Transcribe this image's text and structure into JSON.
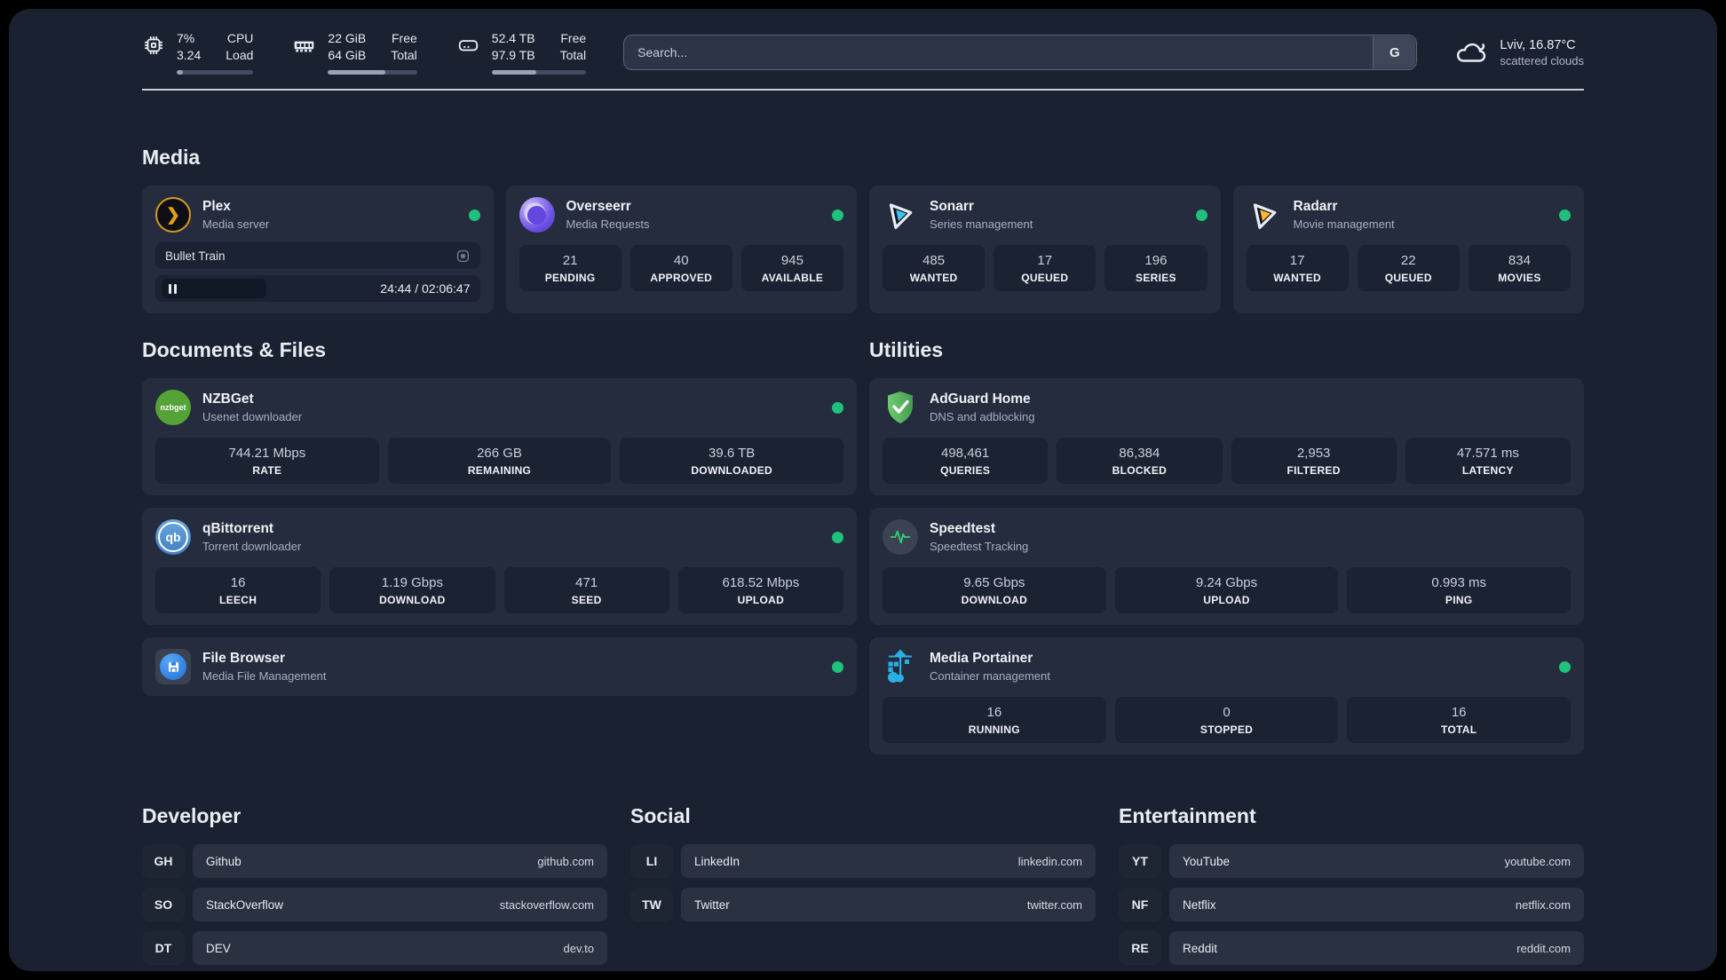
{
  "topbar": {
    "cpu": {
      "v1": "7%",
      "v2": "3.24",
      "l1": "CPU",
      "l2": "Load",
      "progress": 8
    },
    "ram": {
      "v1": "22 GiB",
      "v2": "64 GiB",
      "l1": "Free",
      "l2": "Total",
      "progress": 64
    },
    "disk": {
      "v1": "52.4 TB",
      "v2": "97.9 TB",
      "l1": "Free",
      "l2": "Total",
      "progress": 47
    },
    "search": {
      "placeholder": "Search...",
      "button_label": "G"
    },
    "weather": {
      "line1": "Lviv, 16.87°C",
      "line2": "scattered clouds"
    }
  },
  "media": {
    "title": "Media",
    "plex": {
      "name": "Plex",
      "subtitle": "Media server",
      "now_playing": "Bullet Train",
      "time": "24:44 / 02:06:47"
    },
    "overseerr": {
      "name": "Overseerr",
      "subtitle": "Media Requests",
      "stats": [
        {
          "value": "21",
          "label": "PENDING"
        },
        {
          "value": "40",
          "label": "APPROVED"
        },
        {
          "value": "945",
          "label": "AVAILABLE"
        }
      ]
    },
    "sonarr": {
      "name": "Sonarr",
      "subtitle": "Series management",
      "stats": [
        {
          "value": "485",
          "label": "WANTED"
        },
        {
          "value": "17",
          "label": "QUEUED"
        },
        {
          "value": "196",
          "label": "SERIES"
        }
      ]
    },
    "radarr": {
      "name": "Radarr",
      "subtitle": "Movie management",
      "stats": [
        {
          "value": "17",
          "label": "WANTED"
        },
        {
          "value": "22",
          "label": "QUEUED"
        },
        {
          "value": "834",
          "label": "MOVIES"
        }
      ]
    }
  },
  "documents": {
    "title": "Documents & Files",
    "nzbget": {
      "name": "NZBGet",
      "subtitle": "Usenet downloader",
      "stats": [
        {
          "value": "744.21 Mbps",
          "label": "RATE"
        },
        {
          "value": "266 GB",
          "label": "REMAINING"
        },
        {
          "value": "39.6 TB",
          "label": "DOWNLOADED"
        }
      ]
    },
    "qbittorrent": {
      "name": "qBittorrent",
      "subtitle": "Torrent downloader",
      "stats": [
        {
          "value": "16",
          "label": "LEECH"
        },
        {
          "value": "1.19 Gbps",
          "label": "DOWNLOAD"
        },
        {
          "value": "471",
          "label": "SEED"
        },
        {
          "value": "618.52 Mbps",
          "label": "UPLOAD"
        }
      ]
    },
    "filebrowser": {
      "name": "File Browser",
      "subtitle": "Media File Management"
    }
  },
  "utilities": {
    "title": "Utilities",
    "adguard": {
      "name": "AdGuard Home",
      "subtitle": "DNS and adblocking",
      "stats": [
        {
          "value": "498,461",
          "label": "QUERIES"
        },
        {
          "value": "86,384",
          "label": "BLOCKED"
        },
        {
          "value": "2,953",
          "label": "FILTERED"
        },
        {
          "value": "47.571 ms",
          "label": "LATENCY"
        }
      ]
    },
    "speedtest": {
      "name": "Speedtest",
      "subtitle": "Speedtest Tracking",
      "stats": [
        {
          "value": "9.65 Gbps",
          "label": "DOWNLOAD"
        },
        {
          "value": "9.24 Gbps",
          "label": "UPLOAD"
        },
        {
          "value": "0.993 ms",
          "label": "PING"
        }
      ]
    },
    "portainer": {
      "name": "Media Portainer",
      "subtitle": "Container management",
      "stats": [
        {
          "value": "16",
          "label": "RUNNING"
        },
        {
          "value": "0",
          "label": "STOPPED"
        },
        {
          "value": "16",
          "label": "TOTAL"
        }
      ]
    }
  },
  "bookmarks": {
    "developer": {
      "title": "Developer",
      "links": [
        {
          "abbr": "GH",
          "name": "Github",
          "url": "github.com"
        },
        {
          "abbr": "SO",
          "name": "StackOverflow",
          "url": "stackoverflow.com"
        },
        {
          "abbr": "DT",
          "name": "DEV",
          "url": "dev.to"
        }
      ]
    },
    "social": {
      "title": "Social",
      "links": [
        {
          "abbr": "LI",
          "name": "LinkedIn",
          "url": "linkedin.com"
        },
        {
          "abbr": "TW",
          "name": "Twitter",
          "url": "twitter.com"
        }
      ]
    },
    "entertainment": {
      "title": "Entertainment",
      "links": [
        {
          "abbr": "YT",
          "name": "YouTube",
          "url": "youtube.com"
        },
        {
          "abbr": "NF",
          "name": "Netflix",
          "url": "netflix.com"
        },
        {
          "abbr": "RE",
          "name": "Reddit",
          "url": "reddit.com"
        }
      ]
    }
  },
  "icons": {
    "plex_glyph": "❯",
    "nzbget_text": "nzbget",
    "qbittorrent_text": "qb"
  },
  "colors": {
    "status_online": "#1EC27D",
    "accent_plex": "#E5A00D"
  }
}
